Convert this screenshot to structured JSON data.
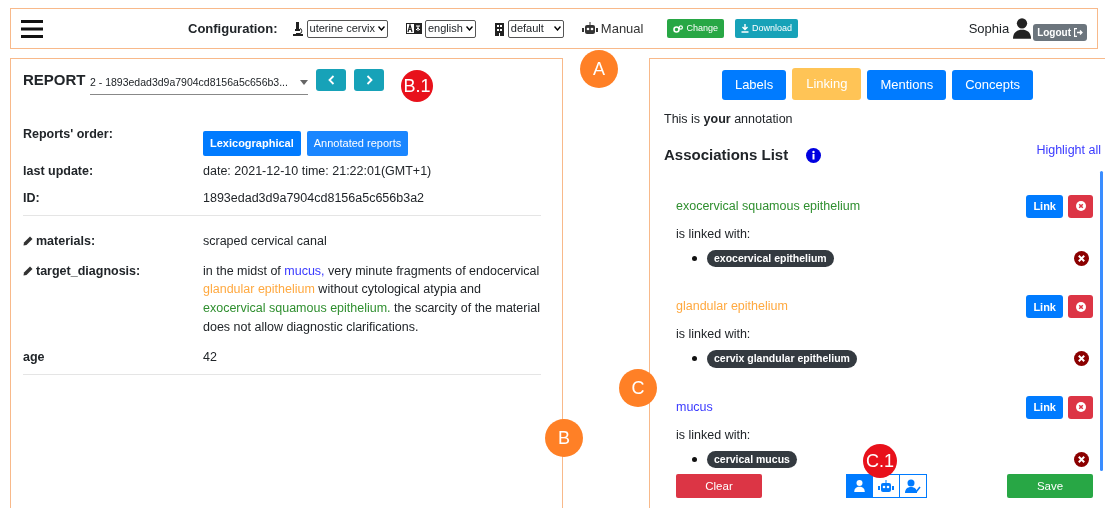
{
  "header": {
    "config_label": "Configuration:",
    "selects": [
      {
        "kind": "microscope",
        "value": "uterine cervix"
      },
      {
        "kind": "language",
        "value": "english"
      },
      {
        "kind": "building",
        "value": "default"
      }
    ],
    "mode": "Manual",
    "buttons": [
      {
        "kind": "change",
        "label": "Change"
      },
      {
        "kind": "download",
        "label": "Download"
      }
    ],
    "user": "Sophia",
    "logout": "Logout"
  },
  "report": {
    "title": "REPORT",
    "selected_report": "2 - 1893edad3d9a7904cd8156a5c656b3...",
    "order_label": "Reports' order:",
    "order_options": [
      {
        "label": "Lexicographical",
        "selected": true
      },
      {
        "label": "Annotated reports",
        "selected": false
      }
    ],
    "meta": [
      {
        "label": "last update:",
        "value": "date: 2021-12-10 time: 21:22:01(GMT+1)"
      },
      {
        "label": "ID:",
        "value": "1893edad3d9a7904cd8156a5c656b3a2"
      }
    ],
    "fields": [
      {
        "label": "materials:",
        "editable": true,
        "segments": [
          {
            "text": "scraped cervical canal"
          }
        ]
      },
      {
        "label": "target_diagnosis:",
        "editable": true,
        "segments": [
          {
            "text": "in the midst of "
          },
          {
            "text": "mucus,",
            "color": "#3a3aff"
          },
          {
            "text": " very minute fragments of endocervical "
          },
          {
            "text": "glandular epithelium",
            "color": "#ffa940"
          },
          {
            "text": " without cytological atypia and "
          },
          {
            "text": "exocervical squamous epithelium.",
            "color": "#2f8f2f"
          },
          {
            "text": " the scarcity of the material does not allow diagnostic clarifications."
          }
        ]
      },
      {
        "label": "age",
        "editable": false,
        "segments": [
          {
            "text": "42"
          }
        ]
      }
    ]
  },
  "annotation": {
    "tabs": [
      {
        "label": "Labels",
        "selected": false
      },
      {
        "label": "Linking",
        "selected": true
      },
      {
        "label": "Mentions",
        "selected": false
      },
      {
        "label": "Concepts",
        "selected": false
      }
    ],
    "note": "This is **your** annotation",
    "list_title": "Associations List",
    "highlight_all": "Highlight all",
    "associations": [
      {
        "mention": "exocervical squamous epithelium",
        "color": "#2f8f2f",
        "link": "Link",
        "linked_text": "is linked with:",
        "concepts": [
          "exocervical epithelium"
        ]
      },
      {
        "mention": "glandular epithelium",
        "color": "#ffa940",
        "link": "Link",
        "linked_text": "is linked with:",
        "concepts": [
          "cervix glandular epithelium"
        ]
      },
      {
        "mention": "mucus",
        "color": "#3a3aff",
        "link": "Link",
        "linked_text": "is linked with:",
        "concepts": [
          "cervical mucus"
        ]
      }
    ],
    "clear": "Clear",
    "modes": [
      {
        "kind": "user",
        "selected": true
      },
      {
        "kind": "robot",
        "selected": false
      },
      {
        "kind": "user-check",
        "selected": false
      }
    ],
    "save": "Save"
  },
  "callouts": [
    {
      "label": "A",
      "color": "#ff8026"
    },
    {
      "label": "B.1",
      "color": "#e8111b"
    },
    {
      "label": "B",
      "color": "#ff8026"
    },
    {
      "label": "C",
      "color": "#ff8026"
    },
    {
      "label": "C.1",
      "color": "#e8111b"
    }
  ]
}
